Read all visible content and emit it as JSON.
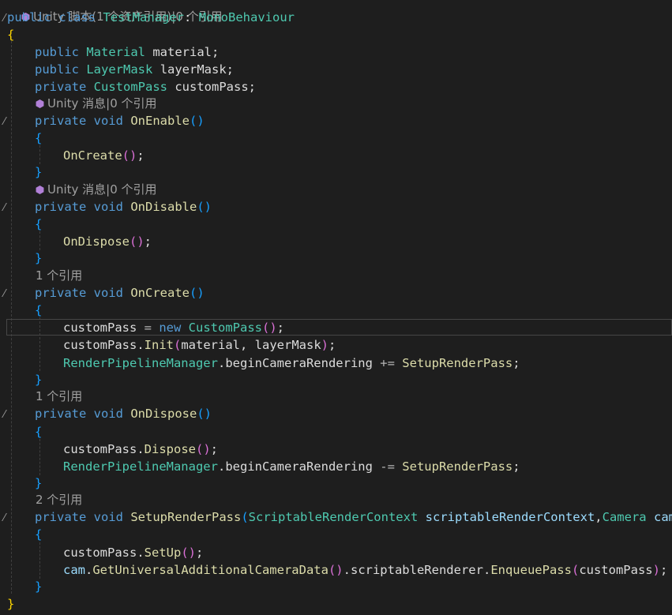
{
  "editor": {
    "top_hint": "Unity 脚本(1 个资产引用)|0 个引用",
    "class_decl": {
      "kw1": "public",
      "kw2": "class",
      "name": "TestManager",
      "sep": ": ",
      "base": "MonoBehaviour"
    },
    "open_brace": "{",
    "close_brace": "}",
    "fields": [
      {
        "mod": "public",
        "type": "Material",
        "name": "material;"
      },
      {
        "mod": "public",
        "type": "LayerMask",
        "name": "layerMask;"
      },
      {
        "mod": "private",
        "type": "CustomPass",
        "name": "customPass;"
      }
    ],
    "hints": {
      "unity_message": "Unity 消息|0 个引用",
      "one_ref": "1 个引用",
      "two_ref": "2 个引用"
    },
    "methods": {
      "on_enable": {
        "mod": "private",
        "ret": "void",
        "name": "OnEnable",
        "parens": "()"
      },
      "on_disable": {
        "mod": "private",
        "ret": "void",
        "name": "OnDisable",
        "parens": "()"
      },
      "on_create": {
        "mod": "private",
        "ret": "void",
        "name": "OnCreate",
        "parens": "()"
      },
      "on_dispose": {
        "mod": "private",
        "ret": "void",
        "name": "OnDispose",
        "parens": "()"
      },
      "setup": {
        "mod": "private",
        "ret": "void",
        "name": "SetupRenderPass",
        "p_open": "(",
        "ptype1": "ScriptableRenderContext",
        "pname1": "scriptableRenderContext",
        "comma": ",",
        "ptype2": "Camera",
        "pname2": "cam",
        "p_close": ")"
      }
    },
    "statements": {
      "call_oncreate": {
        "fn": "OnCreate",
        "parens": "()",
        "end": ";"
      },
      "call_ondispose": {
        "fn": "OnDispose",
        "parens": "()",
        "end": ";"
      },
      "assign": {
        "lhs": "customPass",
        "op": " = ",
        "kw": "new",
        "sp": " ",
        "type": "CustomPass",
        "parens": "()",
        "end": ";"
      },
      "init": {
        "obj": "customPass",
        "dot": ".",
        "fn": "Init",
        "po": "(",
        "args": "material, layerMask",
        "pc": ")",
        "end": ";"
      },
      "subscribe": {
        "type": "RenderPipelineManager",
        "dot": ".",
        "member": "beginCameraRendering",
        "op": " += ",
        "handler": "SetupRenderPass",
        "end": ";"
      },
      "dispose": {
        "obj": "customPass",
        "dot": ".",
        "fn": "Dispose",
        "parens": "()",
        "end": ";"
      },
      "unsubscribe": {
        "type": "RenderPipelineManager",
        "dot": ".",
        "member": "beginCameraRendering",
        "op": " -= ",
        "handler": "SetupRenderPass",
        "end": ";"
      },
      "setup_call": {
        "obj": "customPass",
        "dot": ".",
        "fn": "SetUp",
        "parens": "()",
        "end": ";"
      },
      "enqueue": {
        "obj": "cam",
        "dot1": ".",
        "fn1": "GetUniversalAdditionalCameraData",
        "parens1": "()",
        "dot2": ".",
        "member": "scriptableRenderer",
        "dot3": ".",
        "fn2": "EnqueuePass",
        "po": "(",
        "arg": "customPass",
        "pc": ")",
        "end": ";"
      }
    },
    "colors": {
      "background": "#1e1e1e",
      "keyword": "#569cd6",
      "type": "#4ec9b0",
      "method": "#dcdcaa",
      "variable": "#9cdcfe",
      "bracket_gold": "#ffd700",
      "bracket_pink": "#da70d6",
      "bracket_blue": "#179fff"
    }
  }
}
